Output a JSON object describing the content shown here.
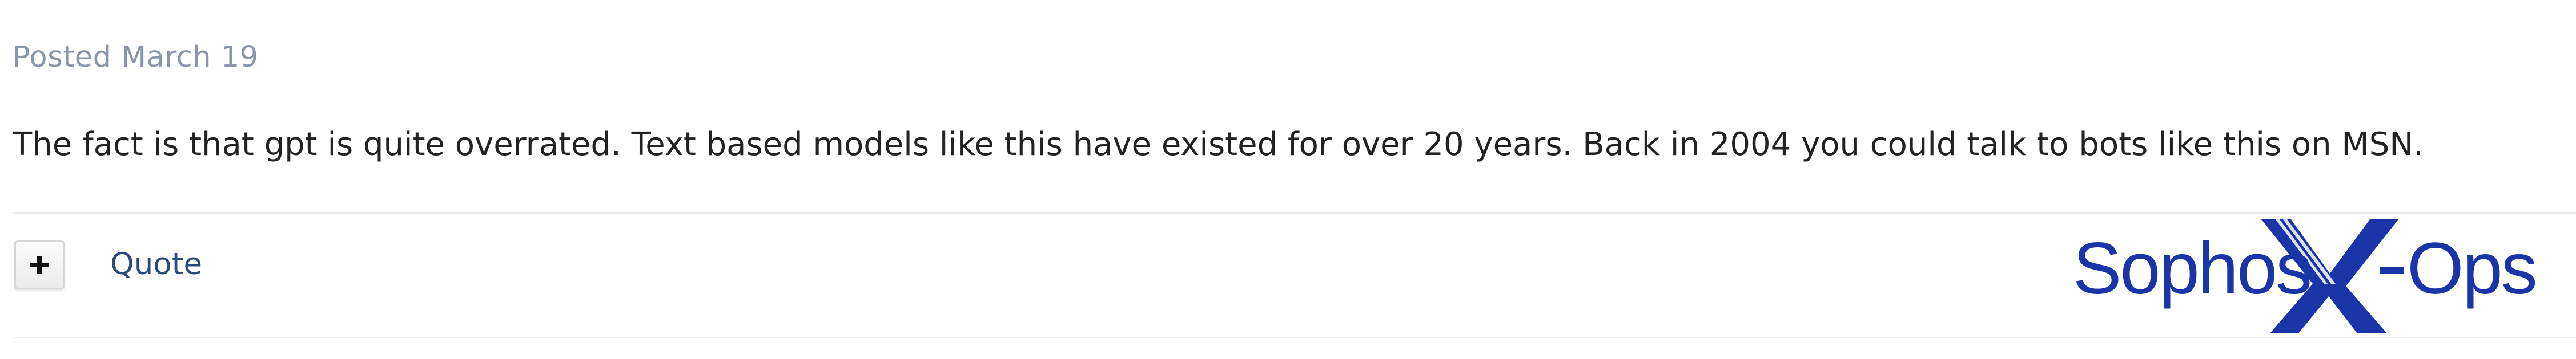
{
  "post": {
    "posted_label": "Posted March 19",
    "body": "The fact is that gpt is quite overrated. Text based models like this have existed for over 20 years. Back in 2004 you could talk to bots like this on MSN."
  },
  "actions": {
    "plus_icon": "plus-icon",
    "quote_label": "Quote"
  },
  "logo": {
    "text": "Sophos X-Ops",
    "color": "#1a35a8"
  },
  "colors": {
    "meta_text": "#8a96a6",
    "body_text": "#222222",
    "link": "#2c4a7a",
    "divider": "#ececec"
  }
}
